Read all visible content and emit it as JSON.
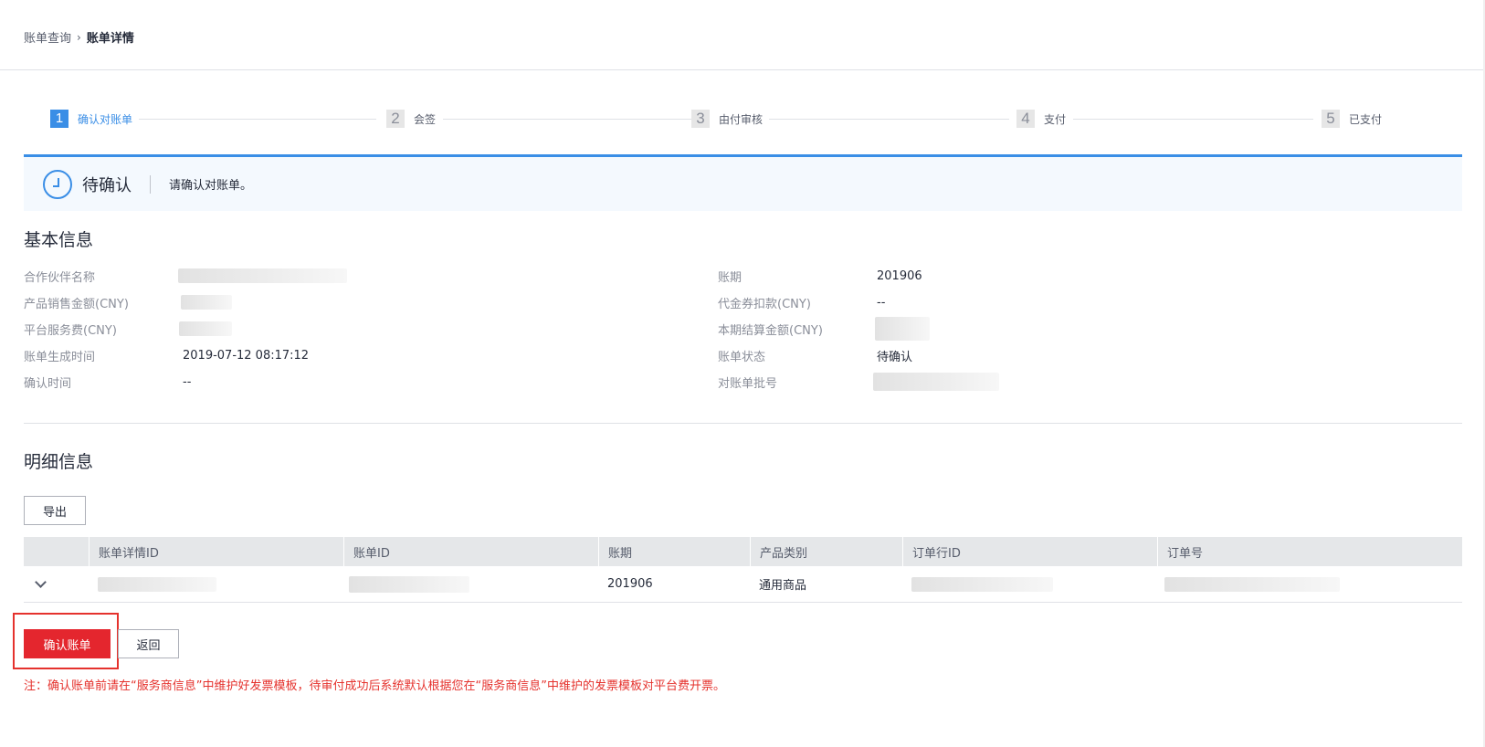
{
  "breadcrumb": {
    "parent": "账单查询",
    "separator": "›",
    "current": "账单详情"
  },
  "steps": [
    {
      "num": "1",
      "label": "确认对账单",
      "active": true
    },
    {
      "num": "2",
      "label": "会签",
      "active": false
    },
    {
      "num": "3",
      "label": "由付审核",
      "active": false
    },
    {
      "num": "4",
      "label": "支付",
      "active": false
    },
    {
      "num": "5",
      "label": "已支付",
      "active": false
    }
  ],
  "status": {
    "title": "待确认",
    "description": "请确认对账单。",
    "icon": "clock-icon",
    "accent_color": "#3a8ee6"
  },
  "basic_info": {
    "title": "基本信息",
    "left": [
      {
        "label": "合作伙伴名称",
        "value": ""
      },
      {
        "label": "产品销售金额(CNY)",
        "value": ""
      },
      {
        "label": "平台服务费(CNY)",
        "value": ""
      },
      {
        "label": "账单生成时间",
        "value": "2019-07-12 08:17:12"
      },
      {
        "label": "确认时间",
        "value": "--"
      }
    ],
    "right": [
      {
        "label": "账期",
        "value": "201906"
      },
      {
        "label": "代金券扣款(CNY)",
        "value": "--"
      },
      {
        "label": "本期结算金额(CNY)",
        "value": ""
      },
      {
        "label": "账单状态",
        "value": "待确认"
      },
      {
        "label": "对账单批号",
        "value": ""
      }
    ]
  },
  "detail_info": {
    "title": "明细信息",
    "export_label": "导出",
    "columns": [
      "账单详情ID",
      "账单ID",
      "账期",
      "产品类别",
      "订单行ID",
      "订单号"
    ],
    "rows": [
      {
        "detail_id": "",
        "bill_id": "",
        "period": "201906",
        "category": "通用商品",
        "order_line_id": "",
        "order_no": ""
      }
    ]
  },
  "actions": {
    "confirm_label": "确认账单",
    "back_label": "返回",
    "confirm_color": "#e4262e"
  },
  "note": "注：确认账单前请在“服务商信息”中维护好发票模板，待审付成功后系统默认根据您在“服务商信息”中维护的发票模板对平台费开票。"
}
